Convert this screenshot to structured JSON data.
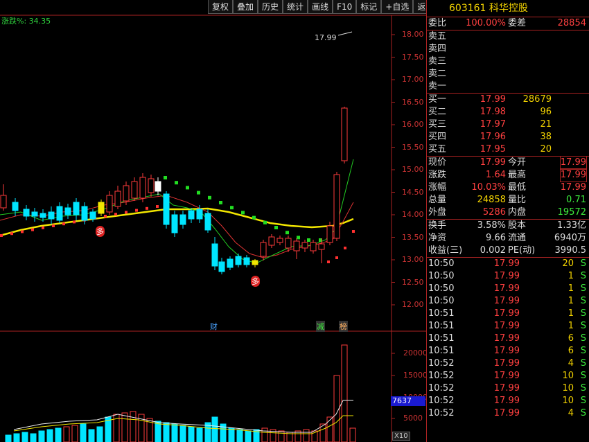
{
  "toolbar": [
    "复权",
    "叠加",
    "历史",
    "统计",
    "画线",
    "F10",
    "标记",
    "+自选",
    "返回"
  ],
  "indicator_label": "涨跌%: 34.35",
  "price_flag": "17.99",
  "price_axis": [
    "18.00",
    "17.50",
    "17.00",
    "16.50",
    "16.00",
    "15.50",
    "15.00",
    "14.50",
    "14.00",
    "13.50",
    "13.00",
    "12.50",
    "12.00"
  ],
  "volume_axis": [
    "20000",
    "15000",
    "10000",
    "5000"
  ],
  "volume_current": "7637",
  "volume_unit": "X10",
  "markers": {
    "cai": "财",
    "jian": "减",
    "bang": "榜",
    "duo": "多"
  },
  "colors": {
    "up": "#ff3b3b",
    "down": "#00e5ff",
    "ma_yellow": "#f2e600",
    "dots_up": "#ff3030",
    "dots_down": "#22dd22",
    "border": "#aa2222"
  },
  "quote": {
    "code": "603161",
    "name": "科华控股",
    "weibi_label": "委比",
    "weibi": "100.00%",
    "weicha_label": "委差",
    "weicha": "28854",
    "asks": [
      {
        "label": "卖五",
        "price": "",
        "vol": ""
      },
      {
        "label": "卖四",
        "price": "",
        "vol": ""
      },
      {
        "label": "卖三",
        "price": "",
        "vol": ""
      },
      {
        "label": "卖二",
        "price": "",
        "vol": ""
      },
      {
        "label": "卖一",
        "price": "",
        "vol": ""
      }
    ],
    "bids": [
      {
        "label": "买一",
        "price": "17.99",
        "vol": "28679"
      },
      {
        "label": "买二",
        "price": "17.98",
        "vol": "96"
      },
      {
        "label": "买三",
        "price": "17.97",
        "vol": "21"
      },
      {
        "label": "买四",
        "price": "17.96",
        "vol": "38"
      },
      {
        "label": "买五",
        "price": "17.95",
        "vol": "20"
      }
    ],
    "stats": [
      {
        "l1": "现价",
        "v1": "17.99",
        "c1": "red",
        "l2": "今开",
        "v2": "17.99",
        "c2": "red",
        "box": true
      },
      {
        "l1": "涨跌",
        "v1": "1.64",
        "c1": "red",
        "l2": "最高",
        "v2": "17.99",
        "c2": "red",
        "box": true
      },
      {
        "l1": "涨幅",
        "v1": "10.03%",
        "c1": "red",
        "l2": "最低",
        "v2": "17.99",
        "c2": "red",
        "box": false
      },
      {
        "l1": "总量",
        "v1": "24858",
        "c1": "yellow",
        "l2": "量比",
        "v2": "0.71",
        "c2": "green",
        "box": false
      },
      {
        "l1": "外盘",
        "v1": "5286",
        "c1": "red",
        "l2": "内盘",
        "v2": "19572",
        "c2": "green",
        "box": false
      }
    ],
    "stats2": [
      {
        "l1": "换手",
        "v1": "3.58%",
        "l2": "股本",
        "v2": "1.33亿"
      },
      {
        "l1": "净资",
        "v1": "9.66",
        "l2": "流通",
        "v2": "6940万"
      },
      {
        "l1": "收益(三)",
        "v1": "0.002",
        "l2": "PE(动)",
        "v2": "3990.5"
      }
    ],
    "ticks": [
      {
        "time": "10:50",
        "price": "17.99",
        "vol": "20",
        "side": "S"
      },
      {
        "time": "10:50",
        "price": "17.99",
        "vol": "1",
        "side": "S"
      },
      {
        "time": "10:50",
        "price": "17.99",
        "vol": "1",
        "side": "S"
      },
      {
        "time": "10:50",
        "price": "17.99",
        "vol": "1",
        "side": "S"
      },
      {
        "time": "10:51",
        "price": "17.99",
        "vol": "1",
        "side": "S"
      },
      {
        "time": "10:51",
        "price": "17.99",
        "vol": "1",
        "side": "S"
      },
      {
        "time": "10:51",
        "price": "17.99",
        "vol": "6",
        "side": "S"
      },
      {
        "time": "10:51",
        "price": "17.99",
        "vol": "6",
        "side": "S"
      },
      {
        "time": "10:52",
        "price": "17.99",
        "vol": "4",
        "side": "S"
      },
      {
        "time": "10:52",
        "price": "17.99",
        "vol": "10",
        "side": "S"
      },
      {
        "time": "10:52",
        "price": "17.99",
        "vol": "10",
        "side": "S"
      },
      {
        "time": "10:52",
        "price": "17.99",
        "vol": "10",
        "side": "S"
      },
      {
        "time": "10:52",
        "price": "17.99",
        "vol": "4",
        "side": "S"
      }
    ]
  }
}
